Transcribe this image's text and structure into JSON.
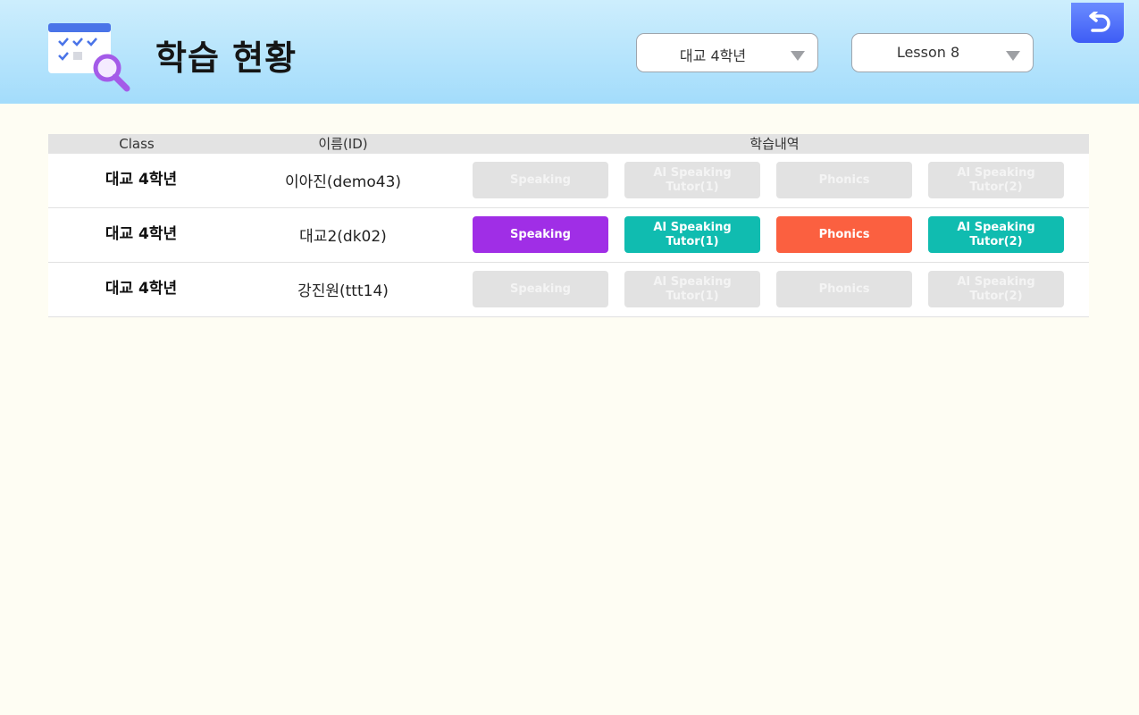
{
  "header": {
    "title": "학습 현황",
    "icon": "calendar-search-icon",
    "class_select": {
      "value": "대교 4학년"
    },
    "lesson_select": {
      "value": "Lesson 8"
    },
    "back_icon": "undo-arrow-icon"
  },
  "table": {
    "headers": {
      "class": "Class",
      "name": "이름(ID)",
      "history": "학습내역"
    },
    "rows": [
      {
        "class": "대교 4학년",
        "name": "이아진(demo43)",
        "activities": [
          {
            "label": "Speaking",
            "completed": false
          },
          {
            "label": "AI Speaking\nTutor(1)",
            "completed": false
          },
          {
            "label": "Phonics",
            "completed": false
          },
          {
            "label": "AI Speaking\nTutor(2)",
            "completed": false
          }
        ]
      },
      {
        "class": "대교 4학년",
        "name": "대교2(dk02)",
        "activities": [
          {
            "label": "Speaking",
            "completed": true
          },
          {
            "label": "AI Speaking\nTutor(1)",
            "completed": true
          },
          {
            "label": "Phonics",
            "completed": true
          },
          {
            "label": "AI Speaking\nTutor(2)",
            "completed": true
          }
        ]
      },
      {
        "class": "대교 4학년",
        "name": "강진원(ttt14)",
        "activities": [
          {
            "label": "Speaking",
            "completed": false
          },
          {
            "label": "AI Speaking\nTutor(1)",
            "completed": false
          },
          {
            "label": "Phonics",
            "completed": false
          },
          {
            "label": "AI Speaking\nTutor(2)",
            "completed": false
          }
        ]
      }
    ]
  },
  "colors": {
    "speaking": "#a02ee6",
    "ai_tutor": "#10bcb0",
    "phonics": "#fb6040",
    "inactive": "#e2e2e2",
    "back_button": "#4a6af8"
  }
}
